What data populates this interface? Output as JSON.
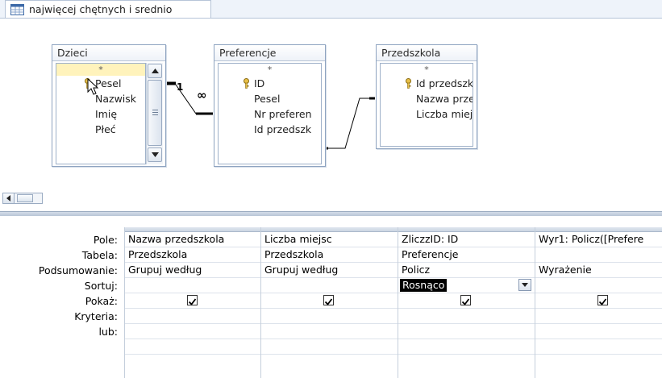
{
  "window": {
    "tab_title": "najwięcej chętnych i srednio"
  },
  "tables": [
    {
      "name": "Dzieci",
      "fields": [
        "*",
        "Pesel",
        "Nazwisk",
        "Imię",
        "Płeć"
      ]
    },
    {
      "name": "Preferencje",
      "fields": [
        "*",
        "ID",
        "Pesel",
        "Nr preferen",
        "Id przedszk"
      ]
    },
    {
      "name": "Przedszkola",
      "fields": [
        "*",
        "Id przedszk",
        "Nazwa prze",
        "Liczba miejs"
      ]
    }
  ],
  "joins": {
    "one_label": "1",
    "many_label": "∞"
  },
  "grid": {
    "row_labels": [
      "Pole:",
      "Tabela:",
      "Podsumowanie:",
      "Sortuj:",
      "Pokaż:",
      "Kryteria:",
      "lub:"
    ],
    "columns": [
      {
        "field": "Nazwa przedszkola",
        "table": "Przedszkola",
        "total": "Grupuj według",
        "sort": "",
        "show": true
      },
      {
        "field": "Liczba miejsc",
        "table": "Przedszkola",
        "total": "Grupuj według",
        "sort": "",
        "show": true
      },
      {
        "field": "ZliczzID: ID",
        "table": "Preferencje",
        "total": "Policz",
        "sort": "Rosnąco",
        "show": true
      },
      {
        "field": "Wyr1: Policz([Prefere",
        "table": "",
        "total": "Wyrażenie",
        "sort": "",
        "show": true
      }
    ]
  },
  "icons": {
    "tab": "query-icon",
    "key": "primary-key-icon",
    "checkbox": "checkmark-icon",
    "dropdown": "dropdown-arrow-icon"
  }
}
